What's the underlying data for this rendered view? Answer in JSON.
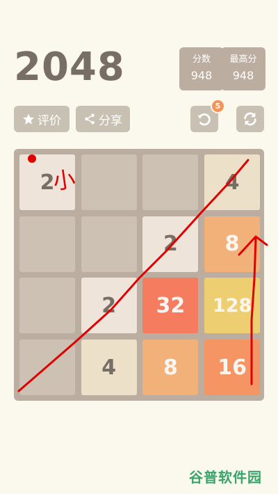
{
  "header": {
    "title": "2048"
  },
  "score": {
    "label": "分数",
    "value": "948"
  },
  "best": {
    "label": "最高分",
    "value": "948"
  },
  "toolbar": {
    "rate_label": "评价",
    "rate_icon": "star-icon",
    "share_label": "分享",
    "share_icon": "share-icon",
    "undo_icon": "undo-icon",
    "undo_count": "5",
    "restart_icon": "restart-icon"
  },
  "board": {
    "rows": [
      [
        "2",
        "",
        "",
        "4"
      ],
      [
        "",
        "",
        "2",
        "8"
      ],
      [
        "",
        "2",
        "32",
        "128"
      ],
      [
        "",
        "4",
        "8",
        "16"
      ]
    ]
  },
  "annotation": {
    "handwritten_text": "小"
  },
  "watermark": {
    "text": "谷普软件园"
  },
  "colors": {
    "background": "#fbf8ee",
    "board": "#bbada0",
    "empty_cell": "#cdc1b4",
    "tile_2": "#eee4da",
    "tile_4": "#ede0c8",
    "tile_8": "#f2b179",
    "tile_16": "#f59563",
    "tile_32": "#f67c5f",
    "tile_128": "#edcf72",
    "annotation": "#e00000",
    "watermark": "#3aa36a"
  }
}
